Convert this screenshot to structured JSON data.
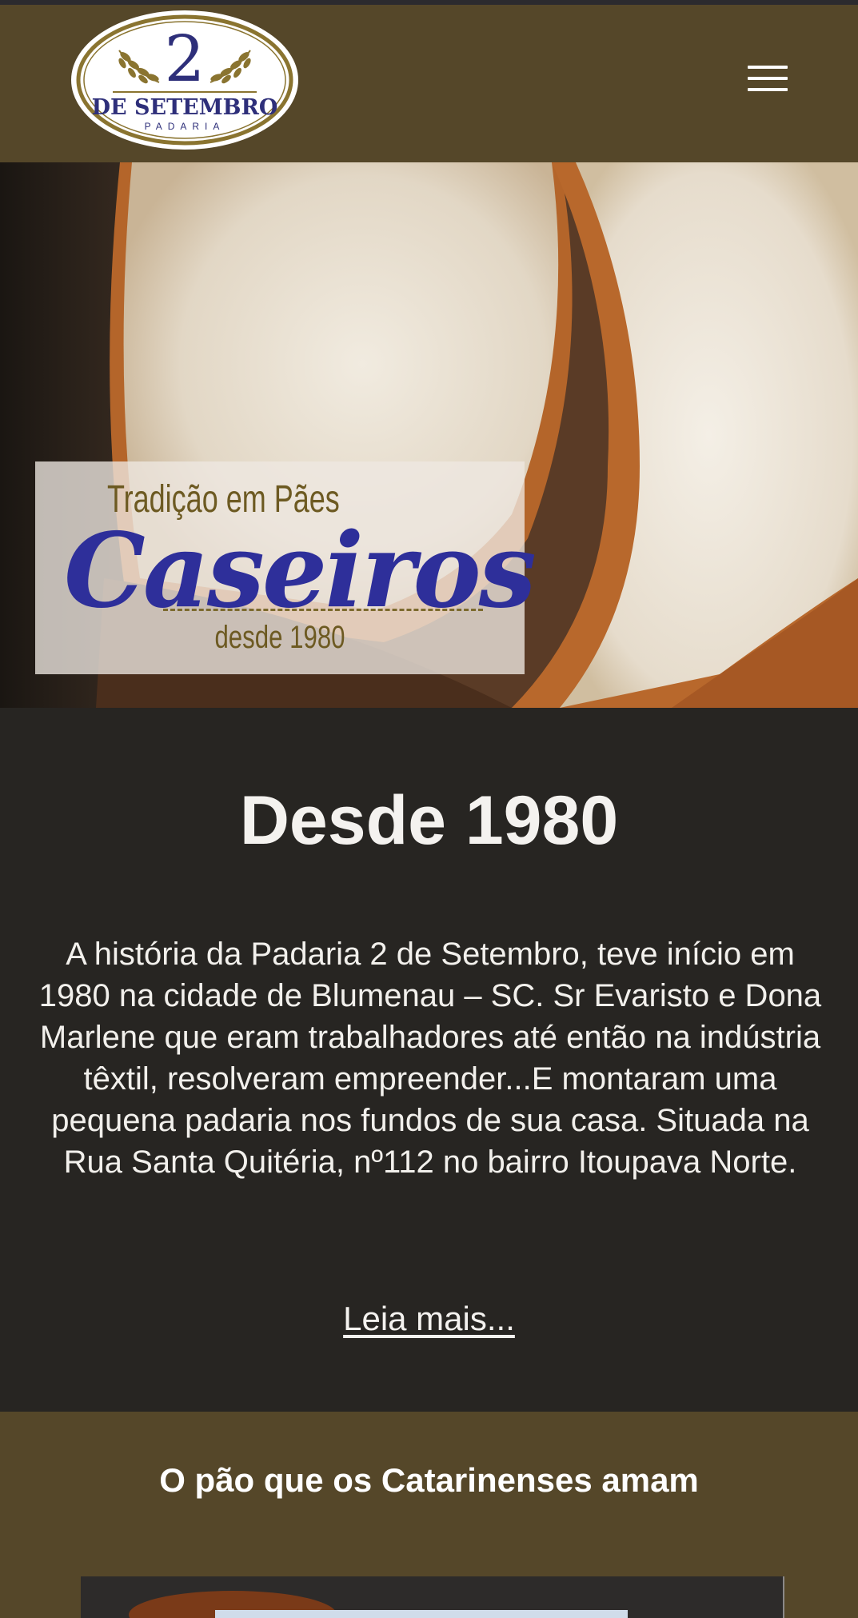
{
  "header": {
    "logo": {
      "number": "2",
      "line1": "DE SETEMBRO",
      "line2": "PADARIA"
    },
    "menu_icon": "hamburger-menu-icon"
  },
  "hero": {
    "banner": {
      "line1": "Tradição em Pães",
      "line2": "Caseiros",
      "line3": "desde 1980"
    }
  },
  "about": {
    "title": "Desde 1980",
    "text": "A história da Padaria 2 de Setembro, teve início em 1980 na cidade de Blumenau – SC. Sr Evaristo e Dona Marlene que eram trabalhadores até então na indústria têxtil, resolveram empreender...E montaram uma pequena padaria nos fundos de sua casa. Situada na Rua Santa Quitéria, nº112 no bairro Itoupava Norte.",
    "link": "Leia mais..."
  },
  "products": {
    "title": "O pão que os Catarinenses amam"
  },
  "colors": {
    "header_bg": "#554729",
    "content_bg": "#272522",
    "brand_blue": "#2e2f9a",
    "brand_gold": "#8a7430"
  }
}
